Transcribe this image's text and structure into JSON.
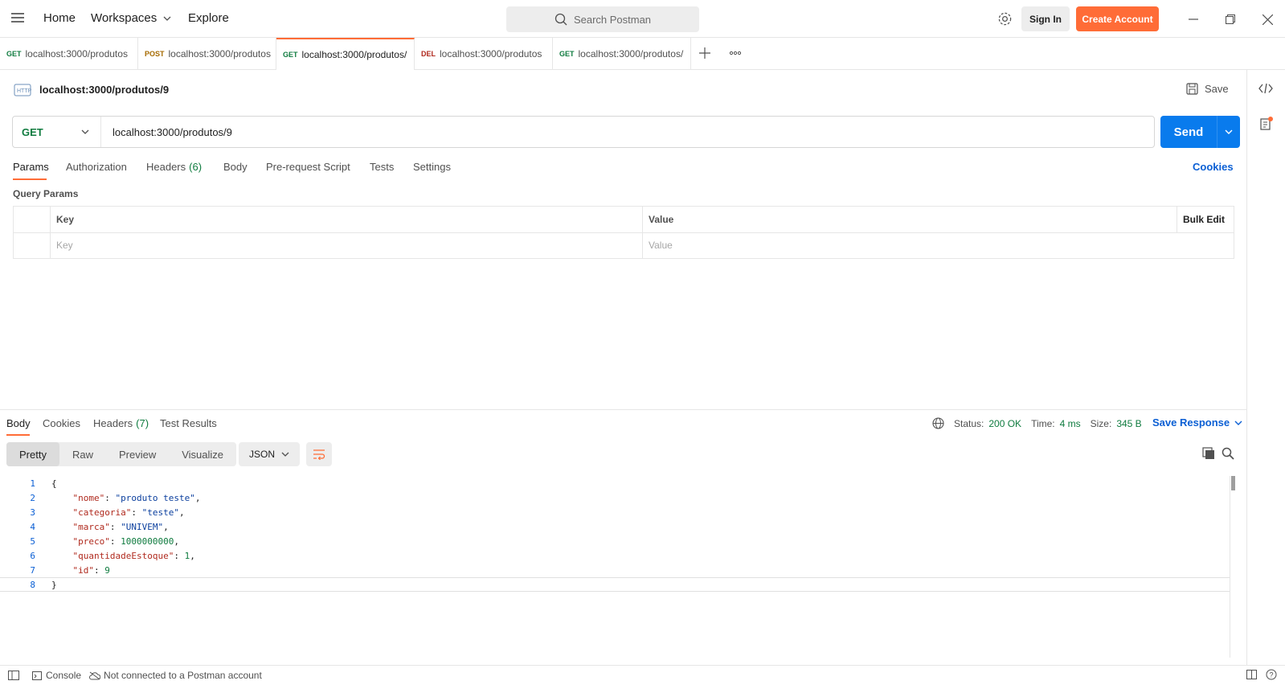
{
  "topbar": {
    "nav": [
      "Home",
      "Workspaces",
      "Explore"
    ],
    "search_placeholder": "Search Postman",
    "sign_in": "Sign In",
    "create_account": "Create Account"
  },
  "tabs": [
    {
      "method": "GET",
      "label": "localhost:3000/produtos"
    },
    {
      "method": "POST",
      "label": "localhost:3000/produtos"
    },
    {
      "method": "GET",
      "label": "localhost:3000/produtos/"
    },
    {
      "method": "DEL",
      "label": "localhost:3000/produtos"
    },
    {
      "method": "GET",
      "label": "localhost:3000/produtos/"
    }
  ],
  "request": {
    "title": "localhost:3000/produtos/9",
    "save": "Save",
    "method": "GET",
    "url": "localhost:3000/produtos/9",
    "send": "Send",
    "tabs": [
      "Params",
      "Authorization",
      "Headers",
      "Body",
      "Pre-request Script",
      "Tests",
      "Settings"
    ],
    "headers_count": "(6)",
    "cookies": "Cookies",
    "query_params_label": "Query Params",
    "table": {
      "key": "Key",
      "value": "Value",
      "bulk": "Bulk Edit",
      "key_ph": "Key",
      "value_ph": "Value"
    }
  },
  "response": {
    "tabs": [
      "Body",
      "Cookies",
      "Headers",
      "Test Results"
    ],
    "headers_count": "(7)",
    "status_label": "Status:",
    "status": "200 OK",
    "time_label": "Time:",
    "time": "4 ms",
    "size_label": "Size:",
    "size": "345 B",
    "save_response": "Save Response",
    "views": [
      "Pretty",
      "Raw",
      "Preview",
      "Visualize"
    ],
    "format": "JSON",
    "lines": [
      "1",
      "2",
      "3",
      "4",
      "5",
      "6",
      "7",
      "8"
    ],
    "body": {
      "open": "{",
      "nome_k": "\"nome\"",
      "nome_v": "\"produto teste\"",
      "categoria_k": "\"categoria\"",
      "categoria_v": "\"teste\"",
      "marca_k": "\"marca\"",
      "marca_v": "\"UNIVEM\"",
      "preco_k": "\"preco\"",
      "preco_v": "1000000000",
      "qtd_k": "\"quantidadeEstoque\"",
      "qtd_v": "1",
      "id_k": "\"id\"",
      "id_v": "9",
      "close": "}"
    }
  },
  "footer": {
    "console": "Console",
    "connection": "Not connected to a Postman account"
  },
  "colors": {
    "accent": "#ff6c37",
    "send": "#097bed",
    "get": "#0f7b3f",
    "post": "#a66a00",
    "del": "#b02a1e"
  }
}
